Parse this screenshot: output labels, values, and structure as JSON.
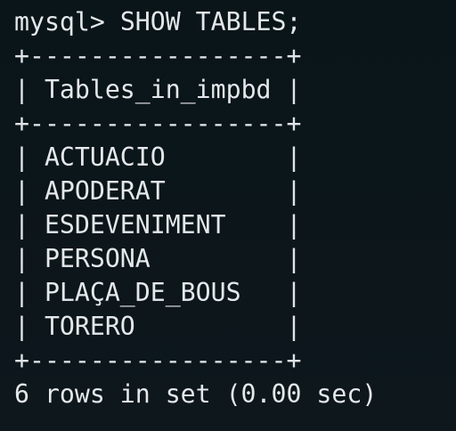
{
  "prompt": "mysql>",
  "command": "SHOW TABLES;",
  "table": {
    "separator": "+-----------------+",
    "header": "Tables_in_impbd",
    "rows": [
      "ACTUACIO",
      "APODERAT",
      "ESDEVENIMENT",
      "PERSONA",
      "PLAÇA_DE_BOUS",
      "TORERO"
    ]
  },
  "result_summary": "6 rows in set (0.00 sec)",
  "colors": {
    "background": "#0b1419",
    "foreground": "#e4e8ea"
  }
}
